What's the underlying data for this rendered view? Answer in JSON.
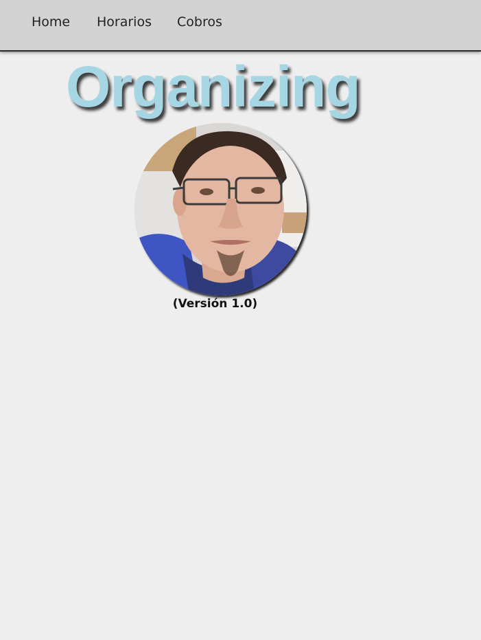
{
  "nav": {
    "items": [
      {
        "label": "Home"
      },
      {
        "label": "Horarios"
      },
      {
        "label": "Cobros"
      }
    ]
  },
  "header": {
    "title": "Organizing"
  },
  "profile": {
    "version_label": "(Versión 1.0)"
  },
  "colors": {
    "page_background": "#eeeeee",
    "navbar_background": "#d3d3d3",
    "title_color": "#a6d6e4"
  }
}
